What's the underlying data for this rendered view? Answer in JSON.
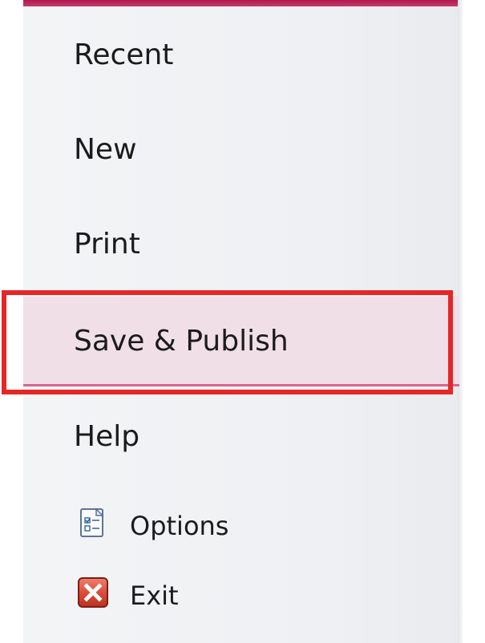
{
  "menu": {
    "items": [
      {
        "label": "Recent"
      },
      {
        "label": "New"
      },
      {
        "label": "Print"
      },
      {
        "label": "Save & Publish"
      },
      {
        "label": "Help"
      }
    ],
    "options": {
      "label": "Options",
      "icon": "options-icon"
    },
    "exit": {
      "label": "Exit",
      "icon": "exit-icon"
    }
  },
  "colors": {
    "accent": "#b0184d",
    "selected_background": "#f1dfe8",
    "highlight_box": "#e52727"
  }
}
